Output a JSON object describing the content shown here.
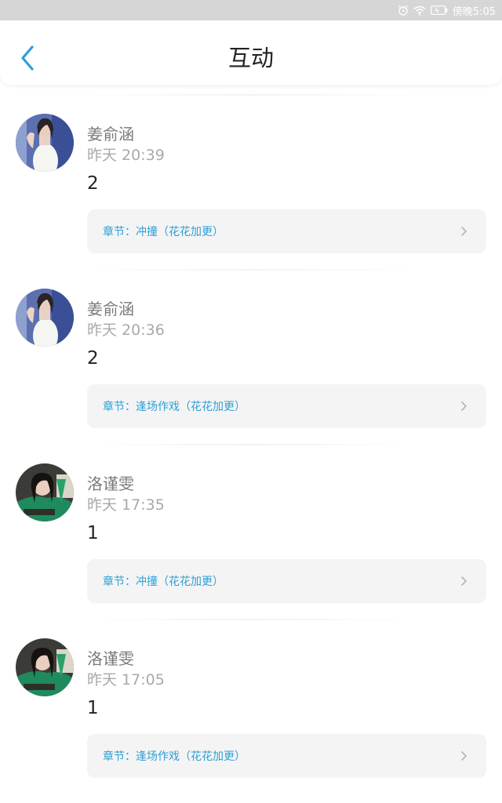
{
  "status_bar": {
    "time": "傍晚5:05"
  },
  "header": {
    "title": "互动"
  },
  "colors": {
    "accent": "#2d9fd6",
    "title_text": "#222222",
    "chapter_bg": "#f4f4f4"
  },
  "items": [
    {
      "name": "姜俞涵",
      "time": "昨天 20:39",
      "content": "2",
      "chapter": "章节：冲撞（花花加更）"
    },
    {
      "name": "姜俞涵",
      "time": "昨天 20:36",
      "content": "2",
      "chapter": "章节：逢场作戏（花花加更）"
    },
    {
      "name": "洛谨雯",
      "time": "昨天 17:35",
      "content": "1",
      "chapter": "章节：冲撞（花花加更）"
    },
    {
      "name": "洛谨雯",
      "time": "昨天 17:05",
      "content": "1",
      "chapter": "章节：逢场作戏（花花加更）"
    }
  ]
}
